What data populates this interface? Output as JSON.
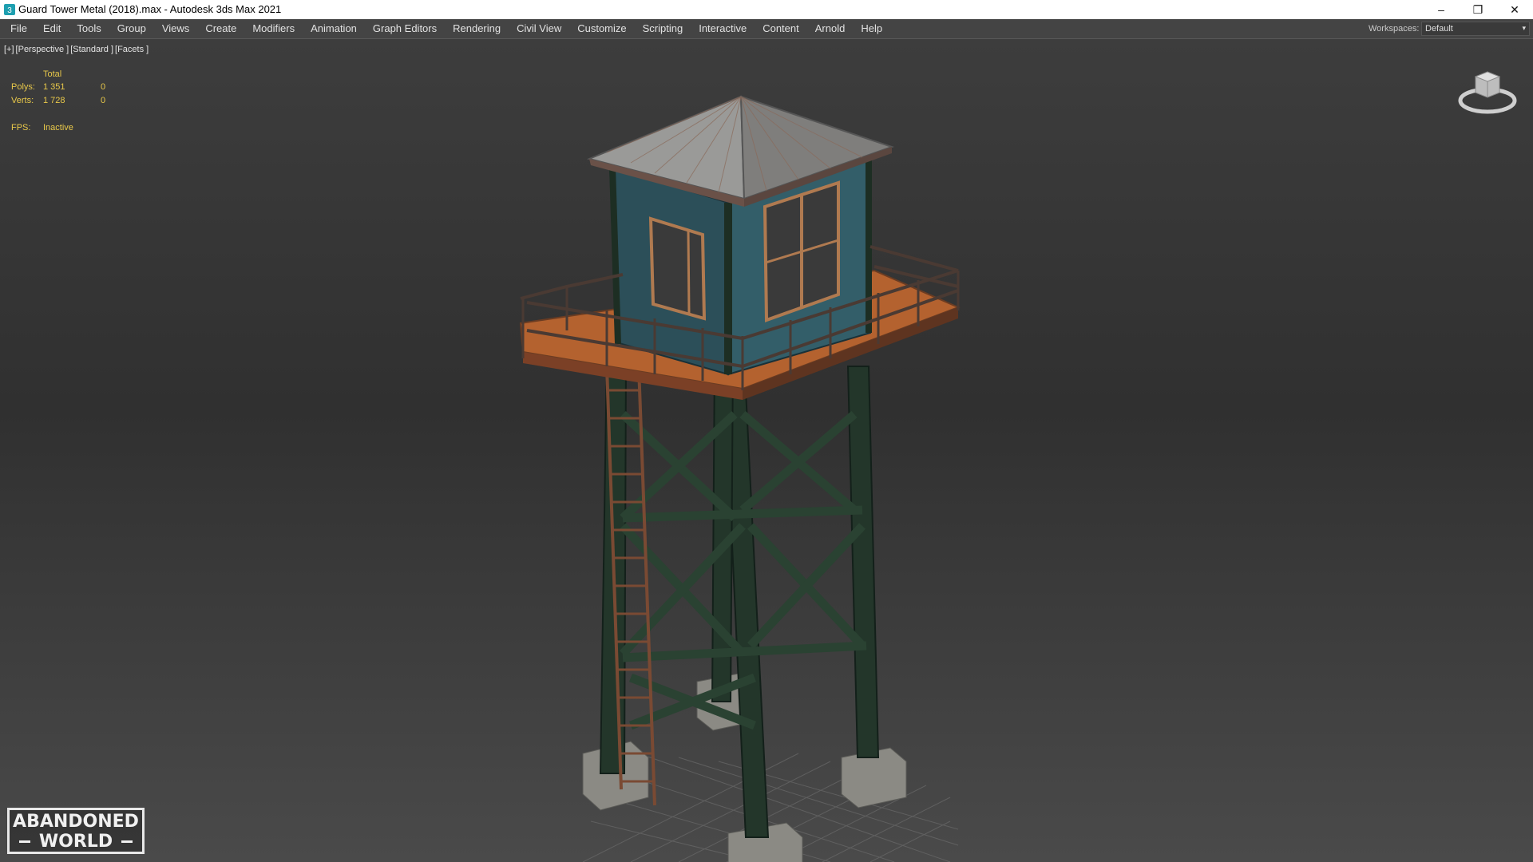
{
  "window": {
    "title": "Guard Tower Metal (2018).max - Autodesk 3ds Max 2021",
    "minimize": "–",
    "restore": "❐",
    "close": "✕"
  },
  "menu": {
    "items": [
      "File",
      "Edit",
      "Tools",
      "Group",
      "Views",
      "Create",
      "Modifiers",
      "Animation",
      "Graph Editors",
      "Rendering",
      "Civil View",
      "Customize",
      "Scripting",
      "Interactive",
      "Content",
      "Arnold",
      "Help"
    ],
    "workspace_label": "Workspaces:",
    "workspace_value": "Default",
    "workspace_arrow": "▾"
  },
  "viewport": {
    "labels": [
      "[+]",
      "[Perspective ]",
      "[Standard ]",
      "[Facets ]"
    ],
    "stats": {
      "header": "Total",
      "polys_label": "Polys:",
      "polys_value": "1 351",
      "polys_sel": "0",
      "verts_label": "Verts:",
      "verts_value": "1 728",
      "verts_sel": "0",
      "fps_label": "FPS:",
      "fps_value": "Inactive"
    }
  },
  "watermark": {
    "line1": "ABANDONED",
    "line2": "WORLD"
  },
  "colors": {
    "menubar": "#444444",
    "stat_text": "#e8c84a",
    "tower_green": "#23362a",
    "cabin_blue": "#2f5560",
    "rust": "#b4622f",
    "roof": "#8a8a8a"
  }
}
